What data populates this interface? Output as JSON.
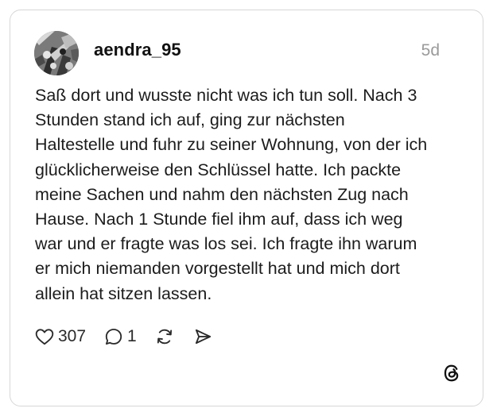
{
  "post": {
    "username": "aendra_95",
    "timestamp": "5d",
    "text_lines": [
      "Saß dort und wusste nicht was ich tun soll. Nach 3",
      "Stunden stand ich auf, ging zur nächsten",
      "Haltestelle und fuhr zu seiner Wohnung, von der ich",
      "glücklicherweise den Schlüssel hatte. Ich packte",
      "meine Sachen und nahm den nächsten Zug nach",
      "Hause. Nach 1 Stunde fiel ihm auf, dass ich weg",
      "war und er fragte was los sei. Ich fragte ihn warum",
      "er mich niemanden vorgestellt hat und mich dort",
      "allein hat sitzen lassen."
    ]
  },
  "actions": {
    "like_count": "307",
    "reply_count": "1"
  },
  "icons": {
    "like": "heart-icon",
    "reply": "comment-icon",
    "repost": "repost-icon",
    "share": "send-icon",
    "brand": "threads-logo-icon"
  },
  "colors": {
    "text": "#1c1c1c",
    "muted": "#9a9a9a",
    "border": "#d7d7d7"
  }
}
